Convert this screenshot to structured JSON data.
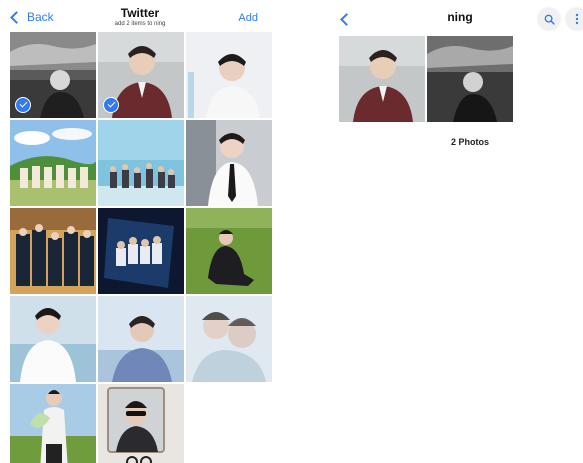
{
  "picker": {
    "back_label": "Back",
    "title": "Twitter",
    "subtitle": "add 2 items to ning",
    "add_label": "Add",
    "photos": [
      {
        "name": "photo-1",
        "selected": true
      },
      {
        "name": "photo-2",
        "selected": true
      },
      {
        "name": "photo-3",
        "selected": false
      },
      {
        "name": "photo-4",
        "selected": false
      },
      {
        "name": "photo-5",
        "selected": false
      },
      {
        "name": "photo-6",
        "selected": false
      },
      {
        "name": "photo-7",
        "selected": false
      },
      {
        "name": "photo-8",
        "selected": false
      },
      {
        "name": "photo-9",
        "selected": false
      },
      {
        "name": "photo-10",
        "selected": false
      },
      {
        "name": "photo-11",
        "selected": false
      },
      {
        "name": "photo-12",
        "selected": false
      },
      {
        "name": "photo-13",
        "selected": false
      },
      {
        "name": "photo-14",
        "selected": false
      }
    ]
  },
  "album": {
    "title": "ning",
    "photo_count_label": "2 Photos"
  },
  "icons": {
    "back": "chevron-left-icon",
    "search": "search-icon",
    "more": "more-vertical-icon",
    "selected": "checkmark-icon"
  },
  "colors": {
    "accent": "#2f7cf6"
  }
}
